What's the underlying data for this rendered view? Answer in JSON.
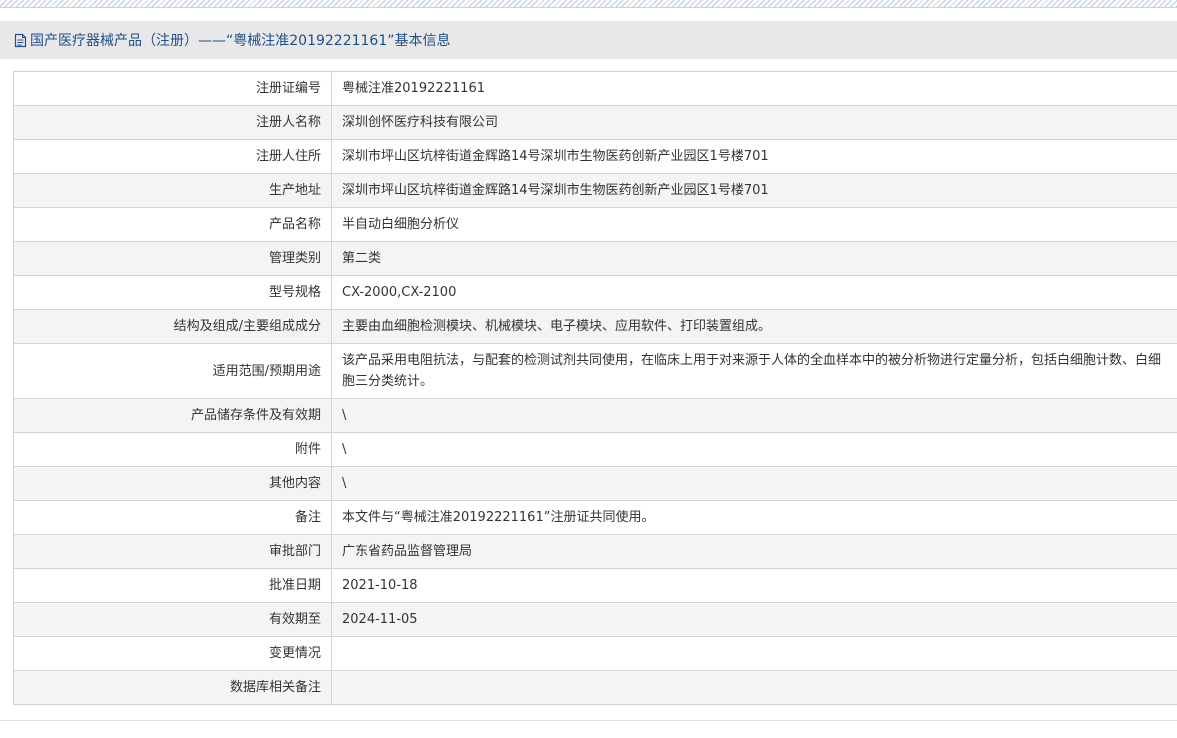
{
  "header": {
    "title": "国产医疗器械产品（注册）——“粤械注准20192221161”基本信息",
    "icon": "document-icon"
  },
  "rows": [
    {
      "label": "注册证编号",
      "value": "粤械注准20192221161"
    },
    {
      "label": "注册人名称",
      "value": "深圳创怀医疗科技有限公司"
    },
    {
      "label": "注册人住所",
      "value": "深圳市坪山区坑梓街道金辉路14号深圳市生物医药创新产业园区1号楼701"
    },
    {
      "label": "生产地址",
      "value": "深圳市坪山区坑梓街道金辉路14号深圳市生物医药创新产业园区1号楼701"
    },
    {
      "label": "产品名称",
      "value": "半自动白细胞分析仪"
    },
    {
      "label": "管理类别",
      "value": "第二类"
    },
    {
      "label": "型号规格",
      "value": "CX-2000,CX-2100"
    },
    {
      "label": "结构及组成/主要组成成分",
      "value": "主要由血细胞检测模块、机械模块、电子模块、应用软件、打印装置组成。"
    },
    {
      "label": "适用范围/预期用途",
      "value": "该产品采用电阻抗法，与配套的检测试剂共同使用，在临床上用于对来源于人体的全血样本中的被分析物进行定量分析，包括白细胞计数、白细胞三分类统计。"
    },
    {
      "label": "产品储存条件及有效期",
      "value": "\\"
    },
    {
      "label": "附件",
      "value": "\\"
    },
    {
      "label": "其他内容",
      "value": "\\"
    },
    {
      "label": "备注",
      "value": "本文件与“粤械注准20192221161”注册证共同使用。"
    },
    {
      "label": "审批部门",
      "value": "广东省药品监督管理局"
    },
    {
      "label": "批准日期",
      "value": "2021-10-18"
    },
    {
      "label": "有效期至",
      "value": "2024-11-05"
    },
    {
      "label": "变更情况",
      "value": ""
    },
    {
      "label": "数据库相关备注",
      "value": ""
    }
  ],
  "colors": {
    "title_text": "#1f4f8c",
    "title_bg": "#e8e8e8",
    "row_alt_bg": "#f4f4f4"
  }
}
